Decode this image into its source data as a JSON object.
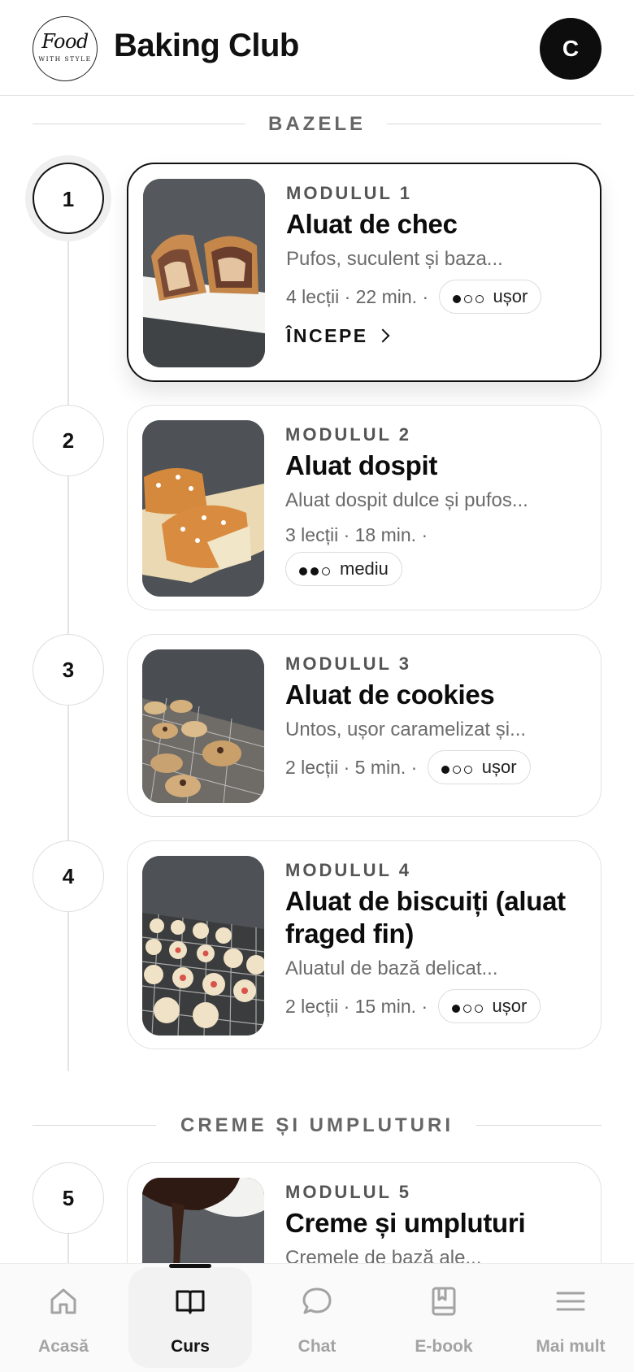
{
  "header": {
    "logo_line1": "Food",
    "logo_line2": "WITH STYLE",
    "title": "Baking Club",
    "avatar_initial": "C"
  },
  "sections": [
    {
      "label": "BAZELE"
    },
    {
      "label": "CREME ȘI UMPLUTURI"
    }
  ],
  "modules": [
    {
      "number": "1",
      "kicker": "MODULUL 1",
      "title": "Aluat de chec",
      "description": "Pufos, suculent și baza...",
      "meta": "4 lecții · 22 min. ·",
      "difficulty": "ușor",
      "difficulty_level": 1,
      "cta": "ÎNCEPE",
      "active": true
    },
    {
      "number": "2",
      "kicker": "MODULUL 2",
      "title": "Aluat dospit",
      "description": "Aluat dospit dulce și pufos...",
      "meta": "3 lecții · 18 min. ·",
      "difficulty": "mediu",
      "difficulty_level": 2
    },
    {
      "number": "3",
      "kicker": "MODULUL 3",
      "title": "Aluat de cookies",
      "description": "Untos, ușor caramelizat și...",
      "meta": "2 lecții · 5 min. ·",
      "difficulty": "ușor",
      "difficulty_level": 1
    },
    {
      "number": "4",
      "kicker": "MODULUL 4",
      "title": "Aluat de biscuiți (aluat fraged fin)",
      "description": "Aluatul de bază delicat...",
      "meta": "2 lecții · 15 min. ·",
      "difficulty": "ușor",
      "difficulty_level": 1
    },
    {
      "number": "5",
      "kicker": "MODULUL 5",
      "title": "Creme și umpluturi",
      "description": "Cremele de bază ale..."
    }
  ],
  "nav": {
    "items": [
      {
        "label": "Acasă",
        "icon": "home-icon"
      },
      {
        "label": "Curs",
        "icon": "book-open-icon",
        "active": true
      },
      {
        "label": "Chat",
        "icon": "chat-bubble-icon"
      },
      {
        "label": "E-book",
        "icon": "ebook-icon"
      },
      {
        "label": "Mai mult",
        "icon": "menu-icon"
      }
    ]
  }
}
